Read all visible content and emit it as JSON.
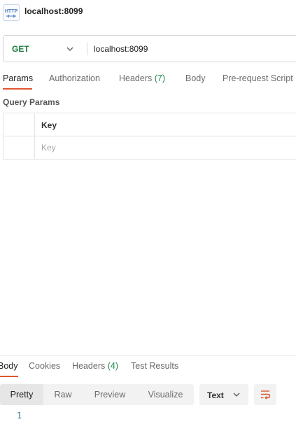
{
  "request": {
    "icon": "http-icon",
    "name": "localhost:8099",
    "method": "GET",
    "url": "localhost:8099"
  },
  "request_tabs": [
    {
      "label": "Params",
      "active": true
    },
    {
      "label": "Authorization"
    },
    {
      "label": "Headers",
      "count": "(7)"
    },
    {
      "label": "Body"
    },
    {
      "label": "Pre-request Script"
    }
  ],
  "query_params": {
    "label": "Query Params",
    "key_header": "Key",
    "key_placeholder": "Key"
  },
  "response_tabs": [
    {
      "label": "Body",
      "active": true
    },
    {
      "label": "Cookies"
    },
    {
      "label": "Headers",
      "count": "(4)"
    },
    {
      "label": "Test Results"
    }
  ],
  "response_view": {
    "modes": [
      "Pretty",
      "Raw",
      "Preview",
      "Visualize"
    ],
    "active_mode": "Pretty",
    "format": "Text",
    "wrap_icon": "wrap-lines-icon",
    "line_numbers": [
      "1"
    ]
  },
  "colors": {
    "accent": "#e0552d",
    "method_get": "#1f7a3f",
    "count": "#1f8a4c"
  }
}
